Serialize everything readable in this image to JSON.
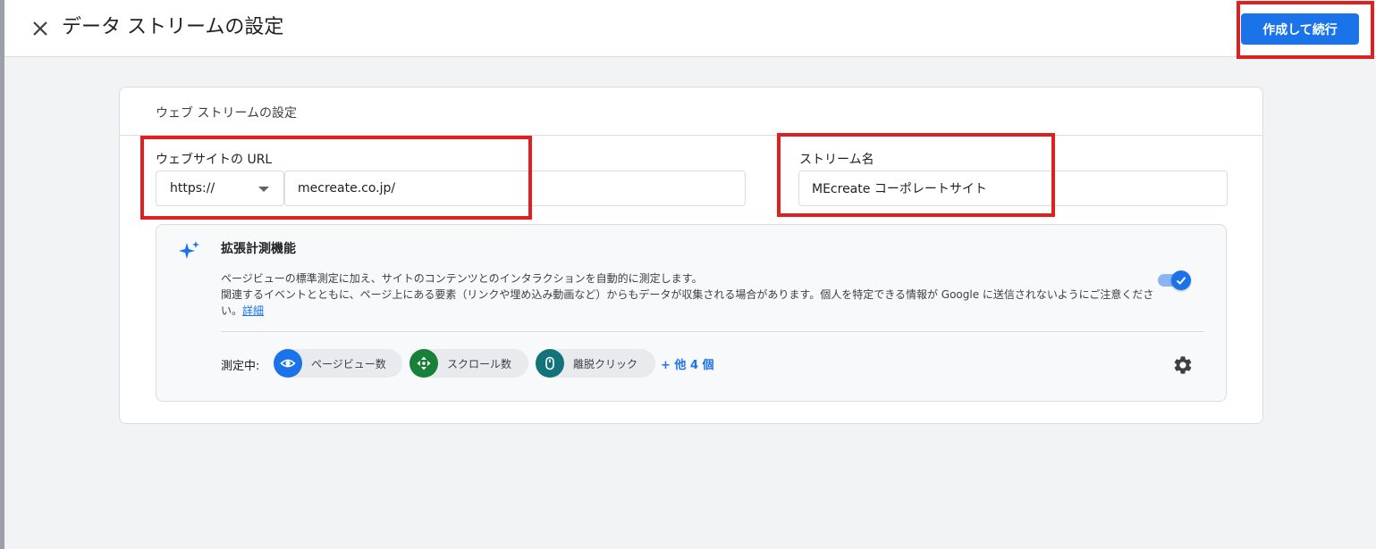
{
  "header": {
    "title": "データ ストリームの設定",
    "primary_button": "作成して続行"
  },
  "card": {
    "title": "ウェブ ストリームの設定",
    "url_field": {
      "label": "ウェブサイトの URL",
      "protocol": "https://",
      "value": "mecreate.co.jp/"
    },
    "stream_name": {
      "label": "ストリーム名",
      "value": "MEcreate コーポレートサイト"
    },
    "enhanced": {
      "title": "拡張計測機能",
      "desc_line1": "ページビューの標準測定に加え、サイトのコンテンツとのインタラクションを自動的に測定します。",
      "desc_line2": "関連するイベントとともに、ページ上にある要素（リンクや埋め込み動画など）からもデータが収集される場合があります。個人を特定できる情報が Google に送信されないようにご注意ください。",
      "details_link": "詳細",
      "enabled": true,
      "measuring_label": "測定中:",
      "chips": [
        {
          "label": "ページビュー数",
          "icon": "eye-icon",
          "color": "#1a73e8"
        },
        {
          "label": "スクロール数",
          "icon": "scroll-arrows-icon",
          "color": "#188038"
        },
        {
          "label": "離脱クリック",
          "icon": "mouse-icon",
          "color": "#12737b"
        }
      ],
      "more_link": "+ 他 4 個"
    }
  },
  "colors": {
    "accent": "#1a73e8",
    "highlight": "#e0201f"
  }
}
